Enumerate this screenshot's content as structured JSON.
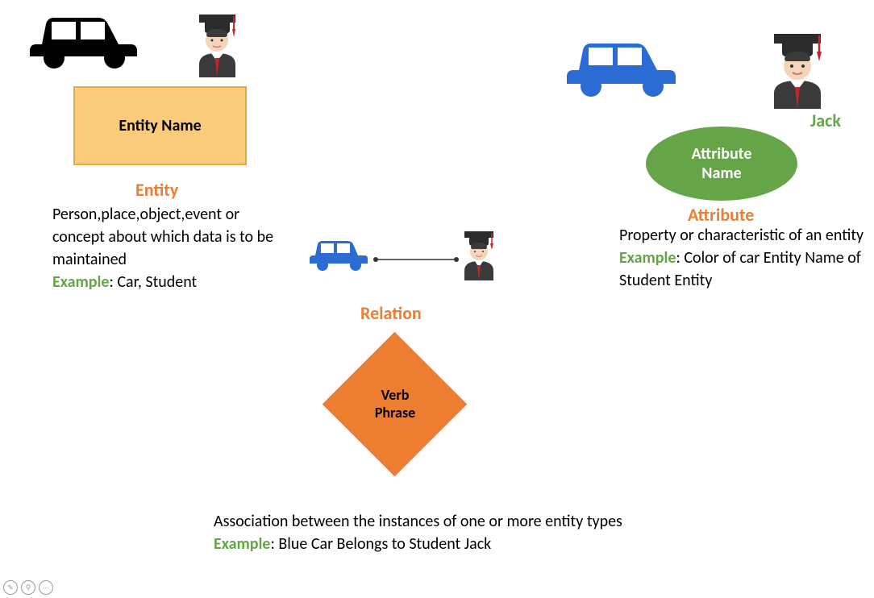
{
  "entity": {
    "shape_label": "Entity Name",
    "heading": "Entity",
    "description": "Person,place,object,event or concept about which data is to be maintained",
    "example_label": "Example",
    "example_text": ": Car, Student"
  },
  "attribute": {
    "shape_label": "Attribute Name",
    "heading": "Attribute",
    "jack_label": "Jack",
    "description": "Property or characteristic of an entity",
    "example_label": "Example",
    "example_text": ": Color of car Entity Name of Student Entity"
  },
  "relation": {
    "shape_label": "Verb Phrase",
    "heading": "Relation",
    "description": "Association between the instances of one or more entity types",
    "example_label": "Example",
    "example_text": ": Blue Car Belongs to Student Jack"
  }
}
